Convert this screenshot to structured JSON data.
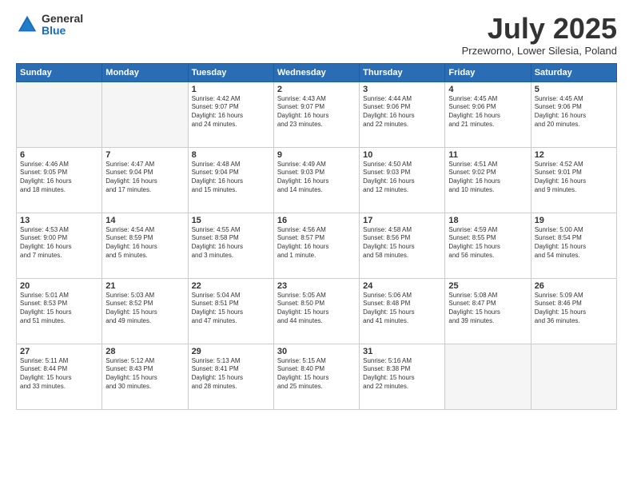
{
  "header": {
    "logo_general": "General",
    "logo_blue": "Blue",
    "month": "July 2025",
    "location": "Przeworno, Lower Silesia, Poland"
  },
  "weekdays": [
    "Sunday",
    "Monday",
    "Tuesday",
    "Wednesday",
    "Thursday",
    "Friday",
    "Saturday"
  ],
  "weeks": [
    [
      {
        "day": "",
        "detail": ""
      },
      {
        "day": "",
        "detail": ""
      },
      {
        "day": "1",
        "detail": "Sunrise: 4:42 AM\nSunset: 9:07 PM\nDaylight: 16 hours\nand 24 minutes."
      },
      {
        "day": "2",
        "detail": "Sunrise: 4:43 AM\nSunset: 9:07 PM\nDaylight: 16 hours\nand 23 minutes."
      },
      {
        "day": "3",
        "detail": "Sunrise: 4:44 AM\nSunset: 9:06 PM\nDaylight: 16 hours\nand 22 minutes."
      },
      {
        "day": "4",
        "detail": "Sunrise: 4:45 AM\nSunset: 9:06 PM\nDaylight: 16 hours\nand 21 minutes."
      },
      {
        "day": "5",
        "detail": "Sunrise: 4:45 AM\nSunset: 9:06 PM\nDaylight: 16 hours\nand 20 minutes."
      }
    ],
    [
      {
        "day": "6",
        "detail": "Sunrise: 4:46 AM\nSunset: 9:05 PM\nDaylight: 16 hours\nand 18 minutes."
      },
      {
        "day": "7",
        "detail": "Sunrise: 4:47 AM\nSunset: 9:04 PM\nDaylight: 16 hours\nand 17 minutes."
      },
      {
        "day": "8",
        "detail": "Sunrise: 4:48 AM\nSunset: 9:04 PM\nDaylight: 16 hours\nand 15 minutes."
      },
      {
        "day": "9",
        "detail": "Sunrise: 4:49 AM\nSunset: 9:03 PM\nDaylight: 16 hours\nand 14 minutes."
      },
      {
        "day": "10",
        "detail": "Sunrise: 4:50 AM\nSunset: 9:03 PM\nDaylight: 16 hours\nand 12 minutes."
      },
      {
        "day": "11",
        "detail": "Sunrise: 4:51 AM\nSunset: 9:02 PM\nDaylight: 16 hours\nand 10 minutes."
      },
      {
        "day": "12",
        "detail": "Sunrise: 4:52 AM\nSunset: 9:01 PM\nDaylight: 16 hours\nand 9 minutes."
      }
    ],
    [
      {
        "day": "13",
        "detail": "Sunrise: 4:53 AM\nSunset: 9:00 PM\nDaylight: 16 hours\nand 7 minutes."
      },
      {
        "day": "14",
        "detail": "Sunrise: 4:54 AM\nSunset: 8:59 PM\nDaylight: 16 hours\nand 5 minutes."
      },
      {
        "day": "15",
        "detail": "Sunrise: 4:55 AM\nSunset: 8:58 PM\nDaylight: 16 hours\nand 3 minutes."
      },
      {
        "day": "16",
        "detail": "Sunrise: 4:56 AM\nSunset: 8:57 PM\nDaylight: 16 hours\nand 1 minute."
      },
      {
        "day": "17",
        "detail": "Sunrise: 4:58 AM\nSunset: 8:56 PM\nDaylight: 15 hours\nand 58 minutes."
      },
      {
        "day": "18",
        "detail": "Sunrise: 4:59 AM\nSunset: 8:55 PM\nDaylight: 15 hours\nand 56 minutes."
      },
      {
        "day": "19",
        "detail": "Sunrise: 5:00 AM\nSunset: 8:54 PM\nDaylight: 15 hours\nand 54 minutes."
      }
    ],
    [
      {
        "day": "20",
        "detail": "Sunrise: 5:01 AM\nSunset: 8:53 PM\nDaylight: 15 hours\nand 51 minutes."
      },
      {
        "day": "21",
        "detail": "Sunrise: 5:03 AM\nSunset: 8:52 PM\nDaylight: 15 hours\nand 49 minutes."
      },
      {
        "day": "22",
        "detail": "Sunrise: 5:04 AM\nSunset: 8:51 PM\nDaylight: 15 hours\nand 47 minutes."
      },
      {
        "day": "23",
        "detail": "Sunrise: 5:05 AM\nSunset: 8:50 PM\nDaylight: 15 hours\nand 44 minutes."
      },
      {
        "day": "24",
        "detail": "Sunrise: 5:06 AM\nSunset: 8:48 PM\nDaylight: 15 hours\nand 41 minutes."
      },
      {
        "day": "25",
        "detail": "Sunrise: 5:08 AM\nSunset: 8:47 PM\nDaylight: 15 hours\nand 39 minutes."
      },
      {
        "day": "26",
        "detail": "Sunrise: 5:09 AM\nSunset: 8:46 PM\nDaylight: 15 hours\nand 36 minutes."
      }
    ],
    [
      {
        "day": "27",
        "detail": "Sunrise: 5:11 AM\nSunset: 8:44 PM\nDaylight: 15 hours\nand 33 minutes."
      },
      {
        "day": "28",
        "detail": "Sunrise: 5:12 AM\nSunset: 8:43 PM\nDaylight: 15 hours\nand 30 minutes."
      },
      {
        "day": "29",
        "detail": "Sunrise: 5:13 AM\nSunset: 8:41 PM\nDaylight: 15 hours\nand 28 minutes."
      },
      {
        "day": "30",
        "detail": "Sunrise: 5:15 AM\nSunset: 8:40 PM\nDaylight: 15 hours\nand 25 minutes."
      },
      {
        "day": "31",
        "detail": "Sunrise: 5:16 AM\nSunset: 8:38 PM\nDaylight: 15 hours\nand 22 minutes."
      },
      {
        "day": "",
        "detail": ""
      },
      {
        "day": "",
        "detail": ""
      }
    ]
  ]
}
